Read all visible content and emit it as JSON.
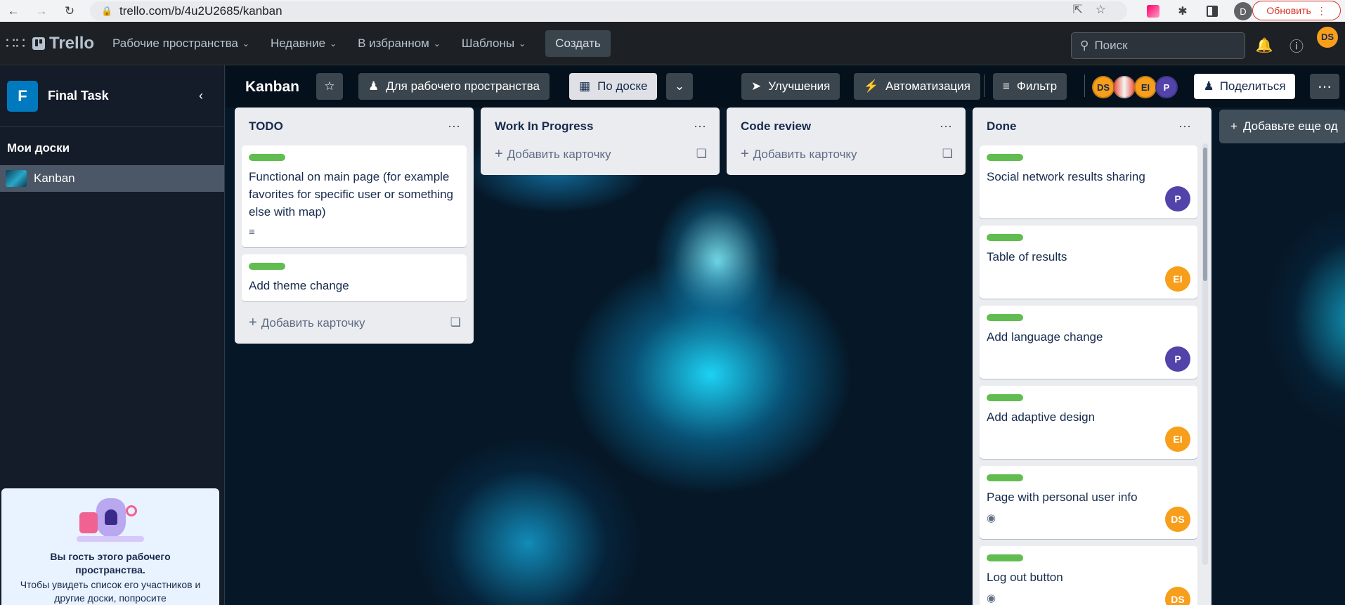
{
  "browser": {
    "url": "trello.com/b/4u2U2685/kanban",
    "profile_initial": "D",
    "update_label": "Обновить"
  },
  "header": {
    "logo_text": "Trello",
    "menu": [
      "Рабочие пространства",
      "Недавние",
      "В избранном",
      "Шаблоны"
    ],
    "create_label": "Создать",
    "search_placeholder": "Поиск",
    "user_initials": "DS"
  },
  "sidebar": {
    "workspace_initial": "F",
    "workspace_name": "Final Task",
    "my_boards_label": "Мои доски",
    "boards": [
      "Kanban"
    ],
    "guest_title": "Вы гость этого рабочего пространства.",
    "guest_text": "Чтобы увидеть список его участников и другие доски, попросите"
  },
  "board": {
    "title": "Kanban",
    "workspace_visibility": "Для рабочего пространства",
    "view_label": "По доске",
    "powerups_label": "Улучшения",
    "automation_label": "Автоматизация",
    "filter_label": "Фильтр",
    "share_label": "Поделиться",
    "add_list_label": "Добавьте еще од",
    "members": [
      {
        "initials": "DS",
        "color": "#f79e1b"
      },
      {
        "initials": "",
        "color": "#eb5a46"
      },
      {
        "initials": "EI",
        "color": "#f79e1b"
      },
      {
        "initials": "P",
        "color": "#5243aa"
      }
    ]
  },
  "lists": [
    {
      "title": "TODO",
      "cards": [
        {
          "text": "Functional on main page (for example favorites for specific user or something else with map)",
          "badge": "description"
        },
        {
          "text": "Add theme change"
        }
      ],
      "add_label": "Добавить карточку"
    },
    {
      "title": "Work In Progress",
      "cards": [],
      "add_label": "Добавить карточку"
    },
    {
      "title": "Code review",
      "cards": [],
      "add_label": "Добавить карточку"
    },
    {
      "title": "Done",
      "cards": [
        {
          "text": "Social network results sharing",
          "member": "P"
        },
        {
          "text": "Table of results",
          "member": "EI"
        },
        {
          "text": "Add language change",
          "member": "P"
        },
        {
          "text": "Add adaptive design",
          "member": "EI"
        },
        {
          "text": "Page with personal user info",
          "member": "DS",
          "badge": "watch"
        },
        {
          "text": "Log out button",
          "member": "DS",
          "badge": "watch"
        }
      ]
    }
  ],
  "colors": {
    "label_green": "#61bd4f",
    "member_orange": "#f79e1b",
    "member_purple": "#5243aa"
  }
}
